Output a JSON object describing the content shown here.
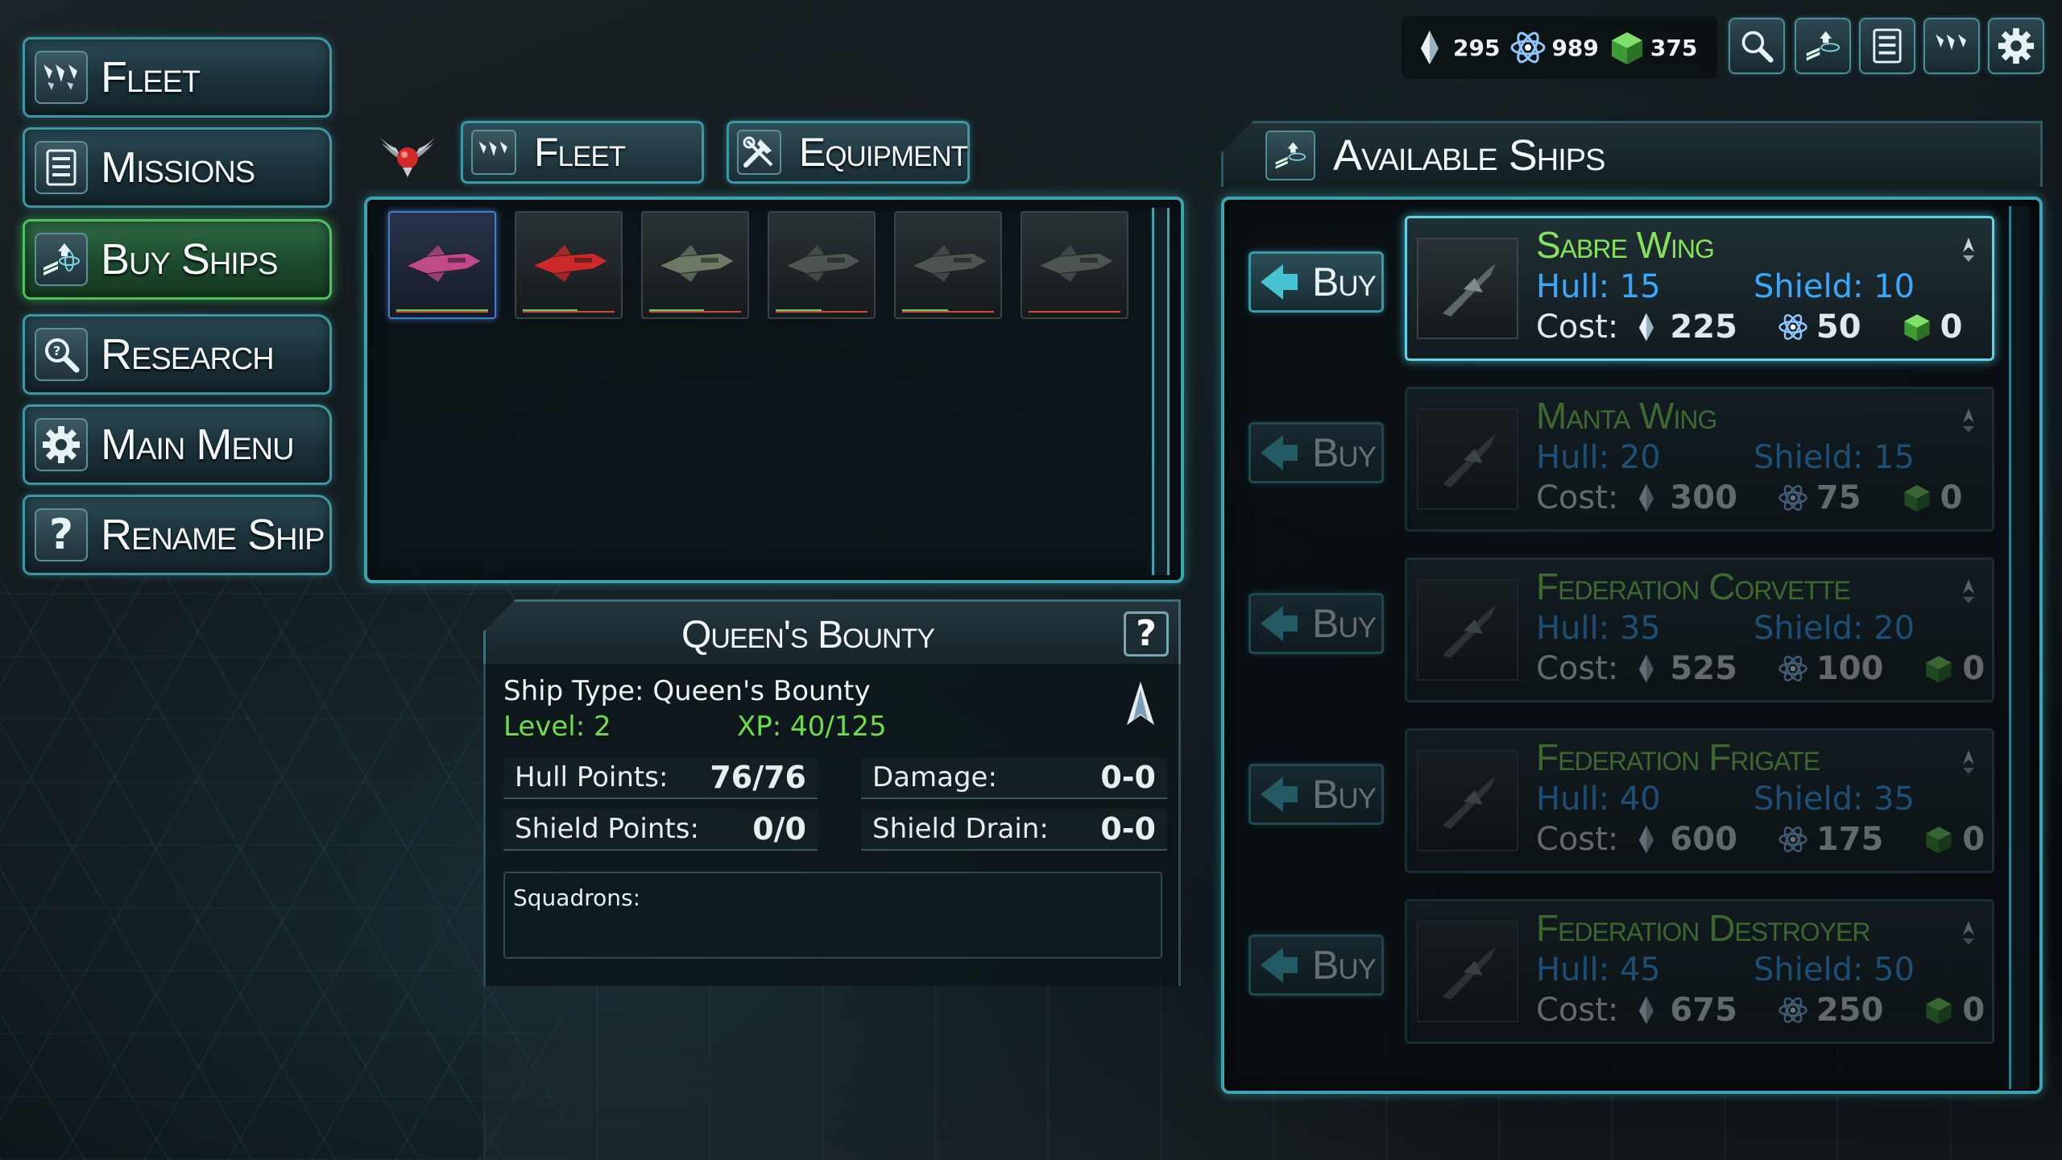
{
  "sidebar": {
    "items": [
      {
        "label": "Fleet",
        "icon": "fleet-icon",
        "active": false
      },
      {
        "label": "Missions",
        "icon": "list-icon",
        "active": false
      },
      {
        "label": "Buy Ships",
        "icon": "buy-ships-icon",
        "active": true
      },
      {
        "label": "Research",
        "icon": "magnifier-icon",
        "active": false
      },
      {
        "label": "Main Menu",
        "icon": "gear-icon",
        "active": false
      },
      {
        "label": "Rename Ship",
        "icon": "question-icon",
        "active": false
      }
    ]
  },
  "tabs": {
    "fleet": "Fleet",
    "equipment": "Equipment"
  },
  "resources": {
    "crystals": "295",
    "atoms": "989",
    "cubes": "375"
  },
  "fleet_slots": [
    {
      "selected": true,
      "color": "#c04a8a",
      "hull_pct": 100
    },
    {
      "selected": false,
      "color": "#cc2a2a",
      "hull_pct": 60
    },
    {
      "selected": false,
      "color": "#6c7a64",
      "hull_pct": 60
    },
    {
      "selected": false,
      "color": "#4c5550",
      "hull_pct": 50
    },
    {
      "selected": false,
      "color": "#4c5550",
      "hull_pct": 50
    },
    {
      "selected": false,
      "color": "#4c5550",
      "hull_pct": 0
    }
  ],
  "selected_ship": {
    "name": "Queen's Bounty",
    "help": "?",
    "type_text": "Ship Type: Queen's Bounty",
    "level_text": "Level: 2",
    "xp_text": "XP: 40/125",
    "hull_label": "Hull Points:",
    "hull_value": "76/76",
    "damage_label": "Damage:",
    "damage_value": "0-0",
    "shield_label": "Shield Points:",
    "shield_value": "0/0",
    "drain_label": "Shield Drain:",
    "drain_value": "0-0",
    "squadrons_label": "Squadrons:"
  },
  "available": {
    "title": "Available Ships",
    "buy_label": "Buy",
    "cost_label": "Cost:",
    "ships": [
      {
        "name": "Sabre Wing",
        "hull": "Hull: 15",
        "shield": "Shield: 10",
        "cost_crystal": "225",
        "cost_atom": "50",
        "cost_cube": "0",
        "available": true
      },
      {
        "name": "Manta Wing",
        "hull": "Hull: 20",
        "shield": "Shield: 15",
        "cost_crystal": "300",
        "cost_atom": "75",
        "cost_cube": "0",
        "available": false
      },
      {
        "name": "Federation Corvette",
        "hull": "Hull: 35",
        "shield": "Shield: 20",
        "cost_crystal": "525",
        "cost_atom": "100",
        "cost_cube": "0",
        "available": false
      },
      {
        "name": "Federation Frigate",
        "hull": "Hull: 40",
        "shield": "Shield: 35",
        "cost_crystal": "600",
        "cost_atom": "175",
        "cost_cube": "0",
        "available": false
      },
      {
        "name": "Federation Destroyer",
        "hull": "Hull: 45",
        "shield": "Shield: 50",
        "cost_crystal": "675",
        "cost_atom": "250",
        "cost_cube": "0",
        "available": false
      }
    ]
  },
  "colors": {
    "accent": "#3ea3b1",
    "active_green": "#4cc45e",
    "ship_name": "#86e25a",
    "stat_blue": "#3aa8ff",
    "level_green": "#6fdc4a"
  }
}
